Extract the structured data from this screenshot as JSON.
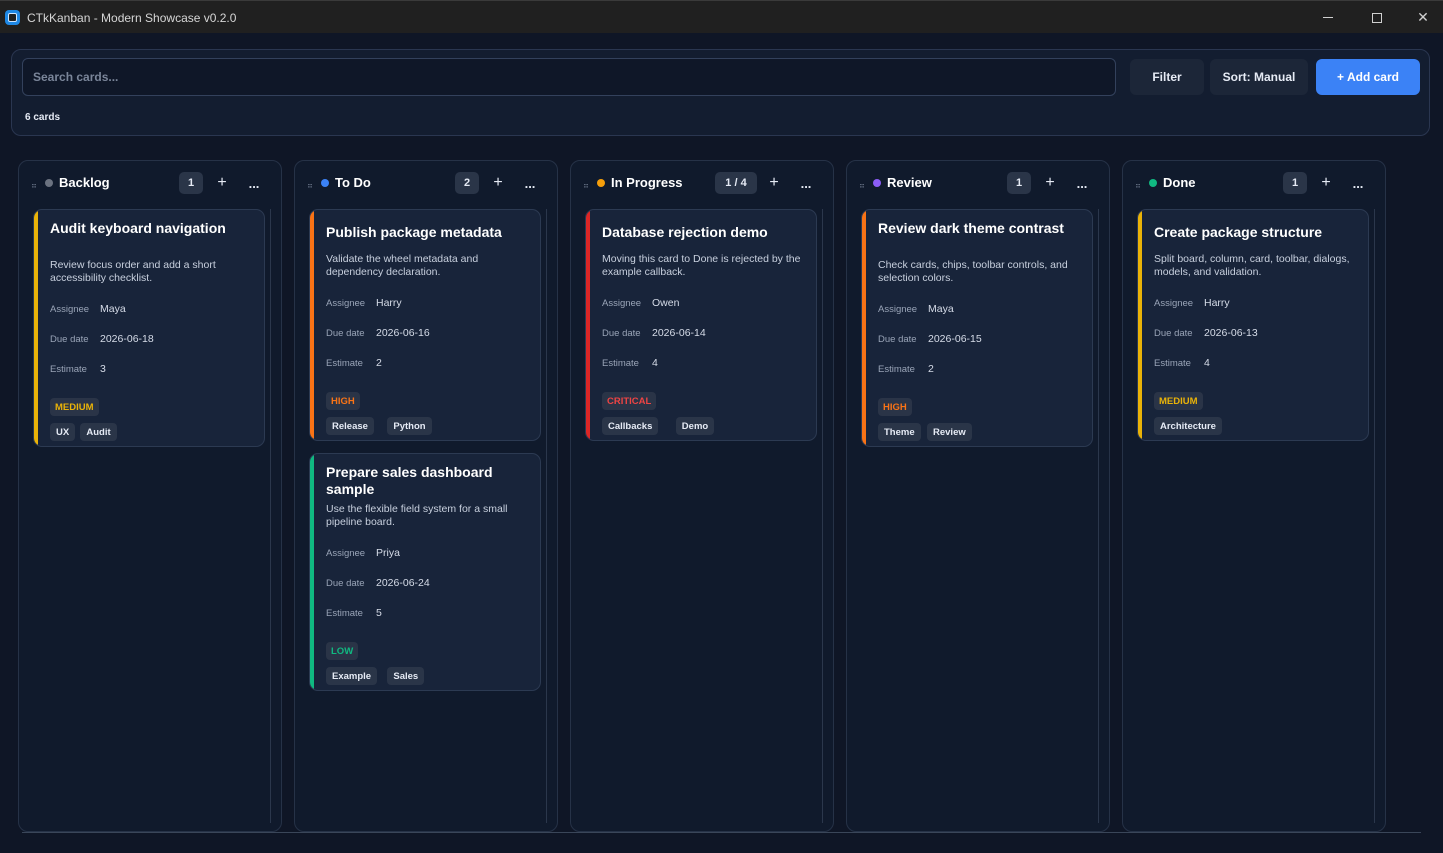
{
  "window": {
    "title": "CTkKanban - Modern Showcase v0.2.0"
  },
  "toolbar": {
    "search_placeholder": "Search cards...",
    "filter_label": "Filter",
    "sort_label": "Sort: Manual",
    "add_label": "+ Add card",
    "card_count": "6 cards"
  },
  "columns": [
    {
      "title": "Backlog",
      "count": "1",
      "dot_color": "#6b7280",
      "add": "+",
      "more": "...",
      "cards": [
        {
          "title": "Audit keyboard navigation",
          "description": "Review focus order and add a short accessibility checklist.",
          "assignee_label": "Assignee",
          "assignee": "Maya",
          "due_label": "Due date",
          "due": "2026-06-18",
          "estimate_label": "Estimate",
          "estimate": "3",
          "priority": "MEDIUM",
          "priority_color": "#eab308",
          "stripe_color": "#eab308",
          "tags": [
            "UX",
            "Audit"
          ]
        }
      ]
    },
    {
      "title": "To Do",
      "count": "2",
      "dot_color": "#3b82f6",
      "add": "+",
      "more": "...",
      "cards": [
        {
          "title": "Publish package metadata",
          "description": "Validate the wheel metadata and dependency declaration.",
          "assignee_label": "Assignee",
          "assignee": "Harry",
          "due_label": "Due date",
          "due": "2026-06-16",
          "estimate_label": "Estimate",
          "estimate": "2",
          "priority": "HIGH",
          "priority_color": "#f97316",
          "stripe_color": "#f97316",
          "tags": [
            "Release",
            "Python"
          ]
        },
        {
          "title": "Prepare sales dashboard sample",
          "description": "Use the flexible field system for a small pipeline board.",
          "assignee_label": "Assignee",
          "assignee": "Priya",
          "due_label": "Due date",
          "due": "2026-06-24",
          "estimate_label": "Estimate",
          "estimate": "5",
          "priority": "LOW",
          "priority_color": "#10b981",
          "stripe_color": "#10b981",
          "tags": [
            "Example",
            "Sales"
          ]
        }
      ]
    },
    {
      "title": "In Progress",
      "count": "1 / 4",
      "dot_color": "#f59e0b",
      "add": "+",
      "more": "...",
      "cards": [
        {
          "title": "Database rejection demo",
          "description": "Moving this card to Done is rejected by the example callback.",
          "assignee_label": "Assignee",
          "assignee": "Owen",
          "due_label": "Due date",
          "due": "2026-06-14",
          "estimate_label": "Estimate",
          "estimate": "4",
          "priority": "CRITICAL",
          "priority_color": "#ef4444",
          "stripe_color": "#dc2626",
          "tags": [
            "Callbacks",
            "Demo"
          ]
        }
      ]
    },
    {
      "title": "Review",
      "count": "1",
      "dot_color": "#8b5cf6",
      "add": "+",
      "more": "...",
      "cards": [
        {
          "title": "Review dark theme contrast",
          "description": "Check cards, chips, toolbar controls, and selection colors.",
          "assignee_label": "Assignee",
          "assignee": "Maya",
          "due_label": "Due date",
          "due": "2026-06-15",
          "estimate_label": "Estimate",
          "estimate": "2",
          "priority": "HIGH",
          "priority_color": "#f97316",
          "stripe_color": "#f97316",
          "tags": [
            "Theme",
            "Review"
          ]
        }
      ]
    },
    {
      "title": "Done",
      "count": "1",
      "dot_color": "#10b981",
      "add": "+",
      "more": "...",
      "cards": [
        {
          "title": "Create package structure",
          "description": "Split board, column, card, toolbar, dialogs, models, and validation.",
          "assignee_label": "Assignee",
          "assignee": "Harry",
          "due_label": "Due date",
          "due": "2026-06-13",
          "estimate_label": "Estimate",
          "estimate": "4",
          "priority": "MEDIUM",
          "priority_color": "#eab308",
          "stripe_color": "#eab308",
          "tags": [
            "Architecture"
          ]
        }
      ]
    }
  ]
}
